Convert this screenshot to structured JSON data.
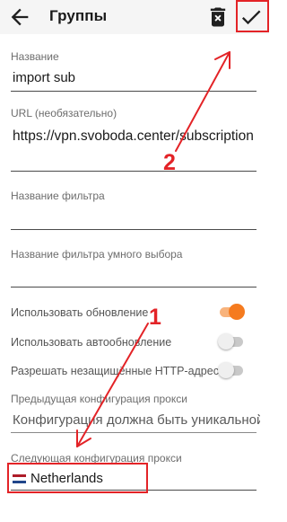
{
  "app_bar": {
    "title": "Группы",
    "back_icon": "arrow-left-icon",
    "delete_icon": "trash-can-icon",
    "save_icon": "checkmark-icon",
    "background": "#f5f5f5"
  },
  "form": {
    "name": {
      "label": "Название",
      "value": "import sub"
    },
    "url": {
      "label": "URL (необязательно)",
      "value": "https://vpn.svoboda.center/subscription"
    },
    "filter_name": {
      "label": "Название фильтра",
      "value": ""
    },
    "smart_filter_name": {
      "label": "Название фильтра умного выбора",
      "value": ""
    },
    "use_update": {
      "label": "Использовать обновление",
      "checked": true
    },
    "use_auto_update": {
      "label": "Использовать автообновление",
      "checked": false
    },
    "allow_insecure_http": {
      "label": "Разрешать незащищённые HTTP-адреса",
      "checked": false
    },
    "previous_proxy": {
      "label": "Предыдущая конфигурация прокси",
      "value": "Конфигурация должна быть уникальной"
    },
    "next_proxy": {
      "label": "Следующая конфигурация прокси",
      "value": "Netherlands",
      "flag": "netherlands-flag-icon"
    }
  },
  "annotations": {
    "step1": "1",
    "step2": "2",
    "color": "#e32327"
  },
  "colors": {
    "accent": "#f57b1f",
    "accent_track": "#f8b37c"
  }
}
